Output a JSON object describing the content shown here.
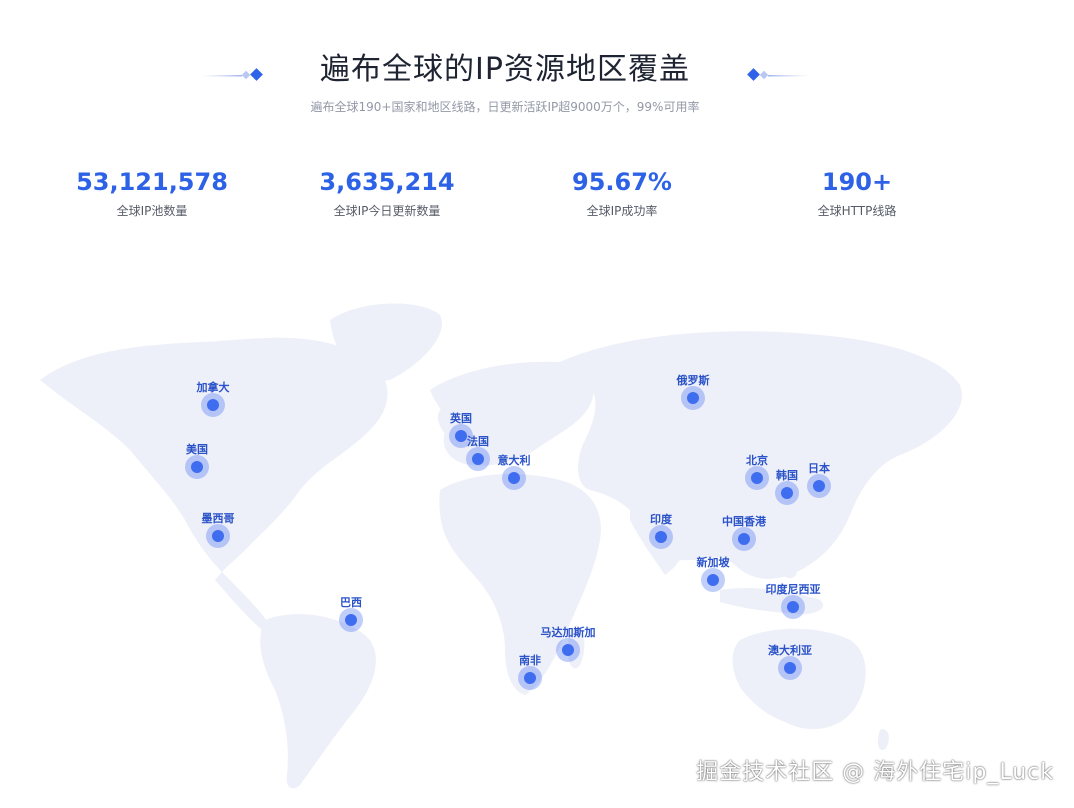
{
  "header": {
    "title": "遍布全球的IP资源地区覆盖",
    "subtitle": "遍布全球190+国家和地区线路，日更新活跃IP超9000万个，99%可用率"
  },
  "stats": [
    {
      "value": "53,121,578",
      "label": "全球IP池数量"
    },
    {
      "value": "3,635,214",
      "label": "全球IP今日更新数量"
    },
    {
      "value": "95.67%",
      "label": "全球IP成功率"
    },
    {
      "value": "190+",
      "label": "全球HTTP线路"
    }
  ],
  "colors": {
    "accent": "#2e62e6",
    "marker": "#3f6df0",
    "land": "#eef0f9"
  },
  "map": {
    "markers": [
      {
        "name": "加拿大"
      },
      {
        "name": "美国"
      },
      {
        "name": "墨西哥"
      },
      {
        "name": "巴西"
      },
      {
        "name": "英国"
      },
      {
        "name": "法国"
      },
      {
        "name": "意大利"
      },
      {
        "name": "俄罗斯"
      },
      {
        "name": "北京"
      },
      {
        "name": "韩国"
      },
      {
        "name": "日本"
      },
      {
        "name": "印度"
      },
      {
        "name": "中国香港"
      },
      {
        "name": "新加坡"
      },
      {
        "name": "印度尼西亚"
      },
      {
        "name": "马达加斯加"
      },
      {
        "name": "南非"
      },
      {
        "name": "澳大利亚"
      }
    ]
  },
  "watermark": "掘金技术社区 @ 海外住宅ip_Luck"
}
